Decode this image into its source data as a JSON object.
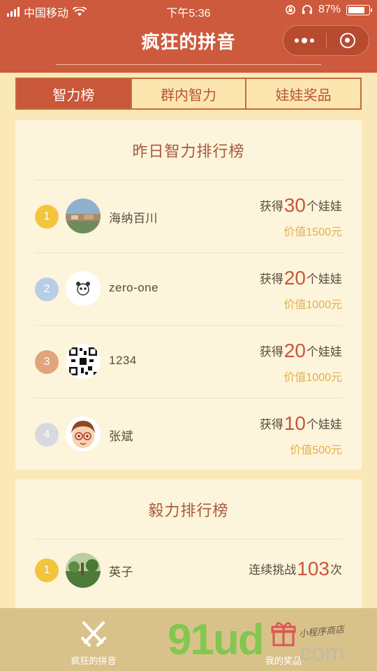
{
  "status_bar": {
    "carrier": "中国移动",
    "time": "下午5:36",
    "battery": "87%",
    "battery_level": 0.87
  },
  "header": {
    "title": "疯狂的拼音"
  },
  "tabs": [
    {
      "label": "智力榜",
      "active": true
    },
    {
      "label": "群内智力",
      "active": false
    },
    {
      "label": "娃娃奖品",
      "active": false
    }
  ],
  "intelligence_board": {
    "title": "昨日智力排行榜",
    "rows": [
      {
        "rank": "1",
        "name": "海纳百川",
        "prefix": "获得",
        "count": "30",
        "suffix": "个娃娃",
        "worth": "价值1500元",
        "rank_color": "#f2c53d"
      },
      {
        "rank": "2",
        "name": "zero-one",
        "prefix": "获得",
        "count": "20",
        "suffix": "个娃娃",
        "worth": "价值1000元",
        "rank_color": "#b8cde6"
      },
      {
        "rank": "3",
        "name": "1234",
        "prefix": "获得",
        "count": "20",
        "suffix": "个娃娃",
        "worth": "价值1000元",
        "rank_color": "#e0a57a"
      },
      {
        "rank": "4",
        "name": "张斌",
        "prefix": "获得",
        "count": "10",
        "suffix": "个娃娃",
        "worth": "价值500元",
        "rank_color": "#d8d8de"
      }
    ]
  },
  "perseverance_board": {
    "title": "毅力排行榜",
    "rows": [
      {
        "rank": "1",
        "name": "英子",
        "prefix": "连续挑战",
        "count": "103",
        "suffix": "次",
        "rank_color": "#f2c53d"
      }
    ]
  },
  "bottom_bar": {
    "items": [
      {
        "label": "疯狂的拼音",
        "icon": "crossed-swords-icon"
      },
      {
        "label": "我的奖品",
        "icon": "gift-icon"
      }
    ]
  },
  "watermark": {
    "brand": "91ud",
    "domain": ".com",
    "tagline": "小程序商店"
  }
}
